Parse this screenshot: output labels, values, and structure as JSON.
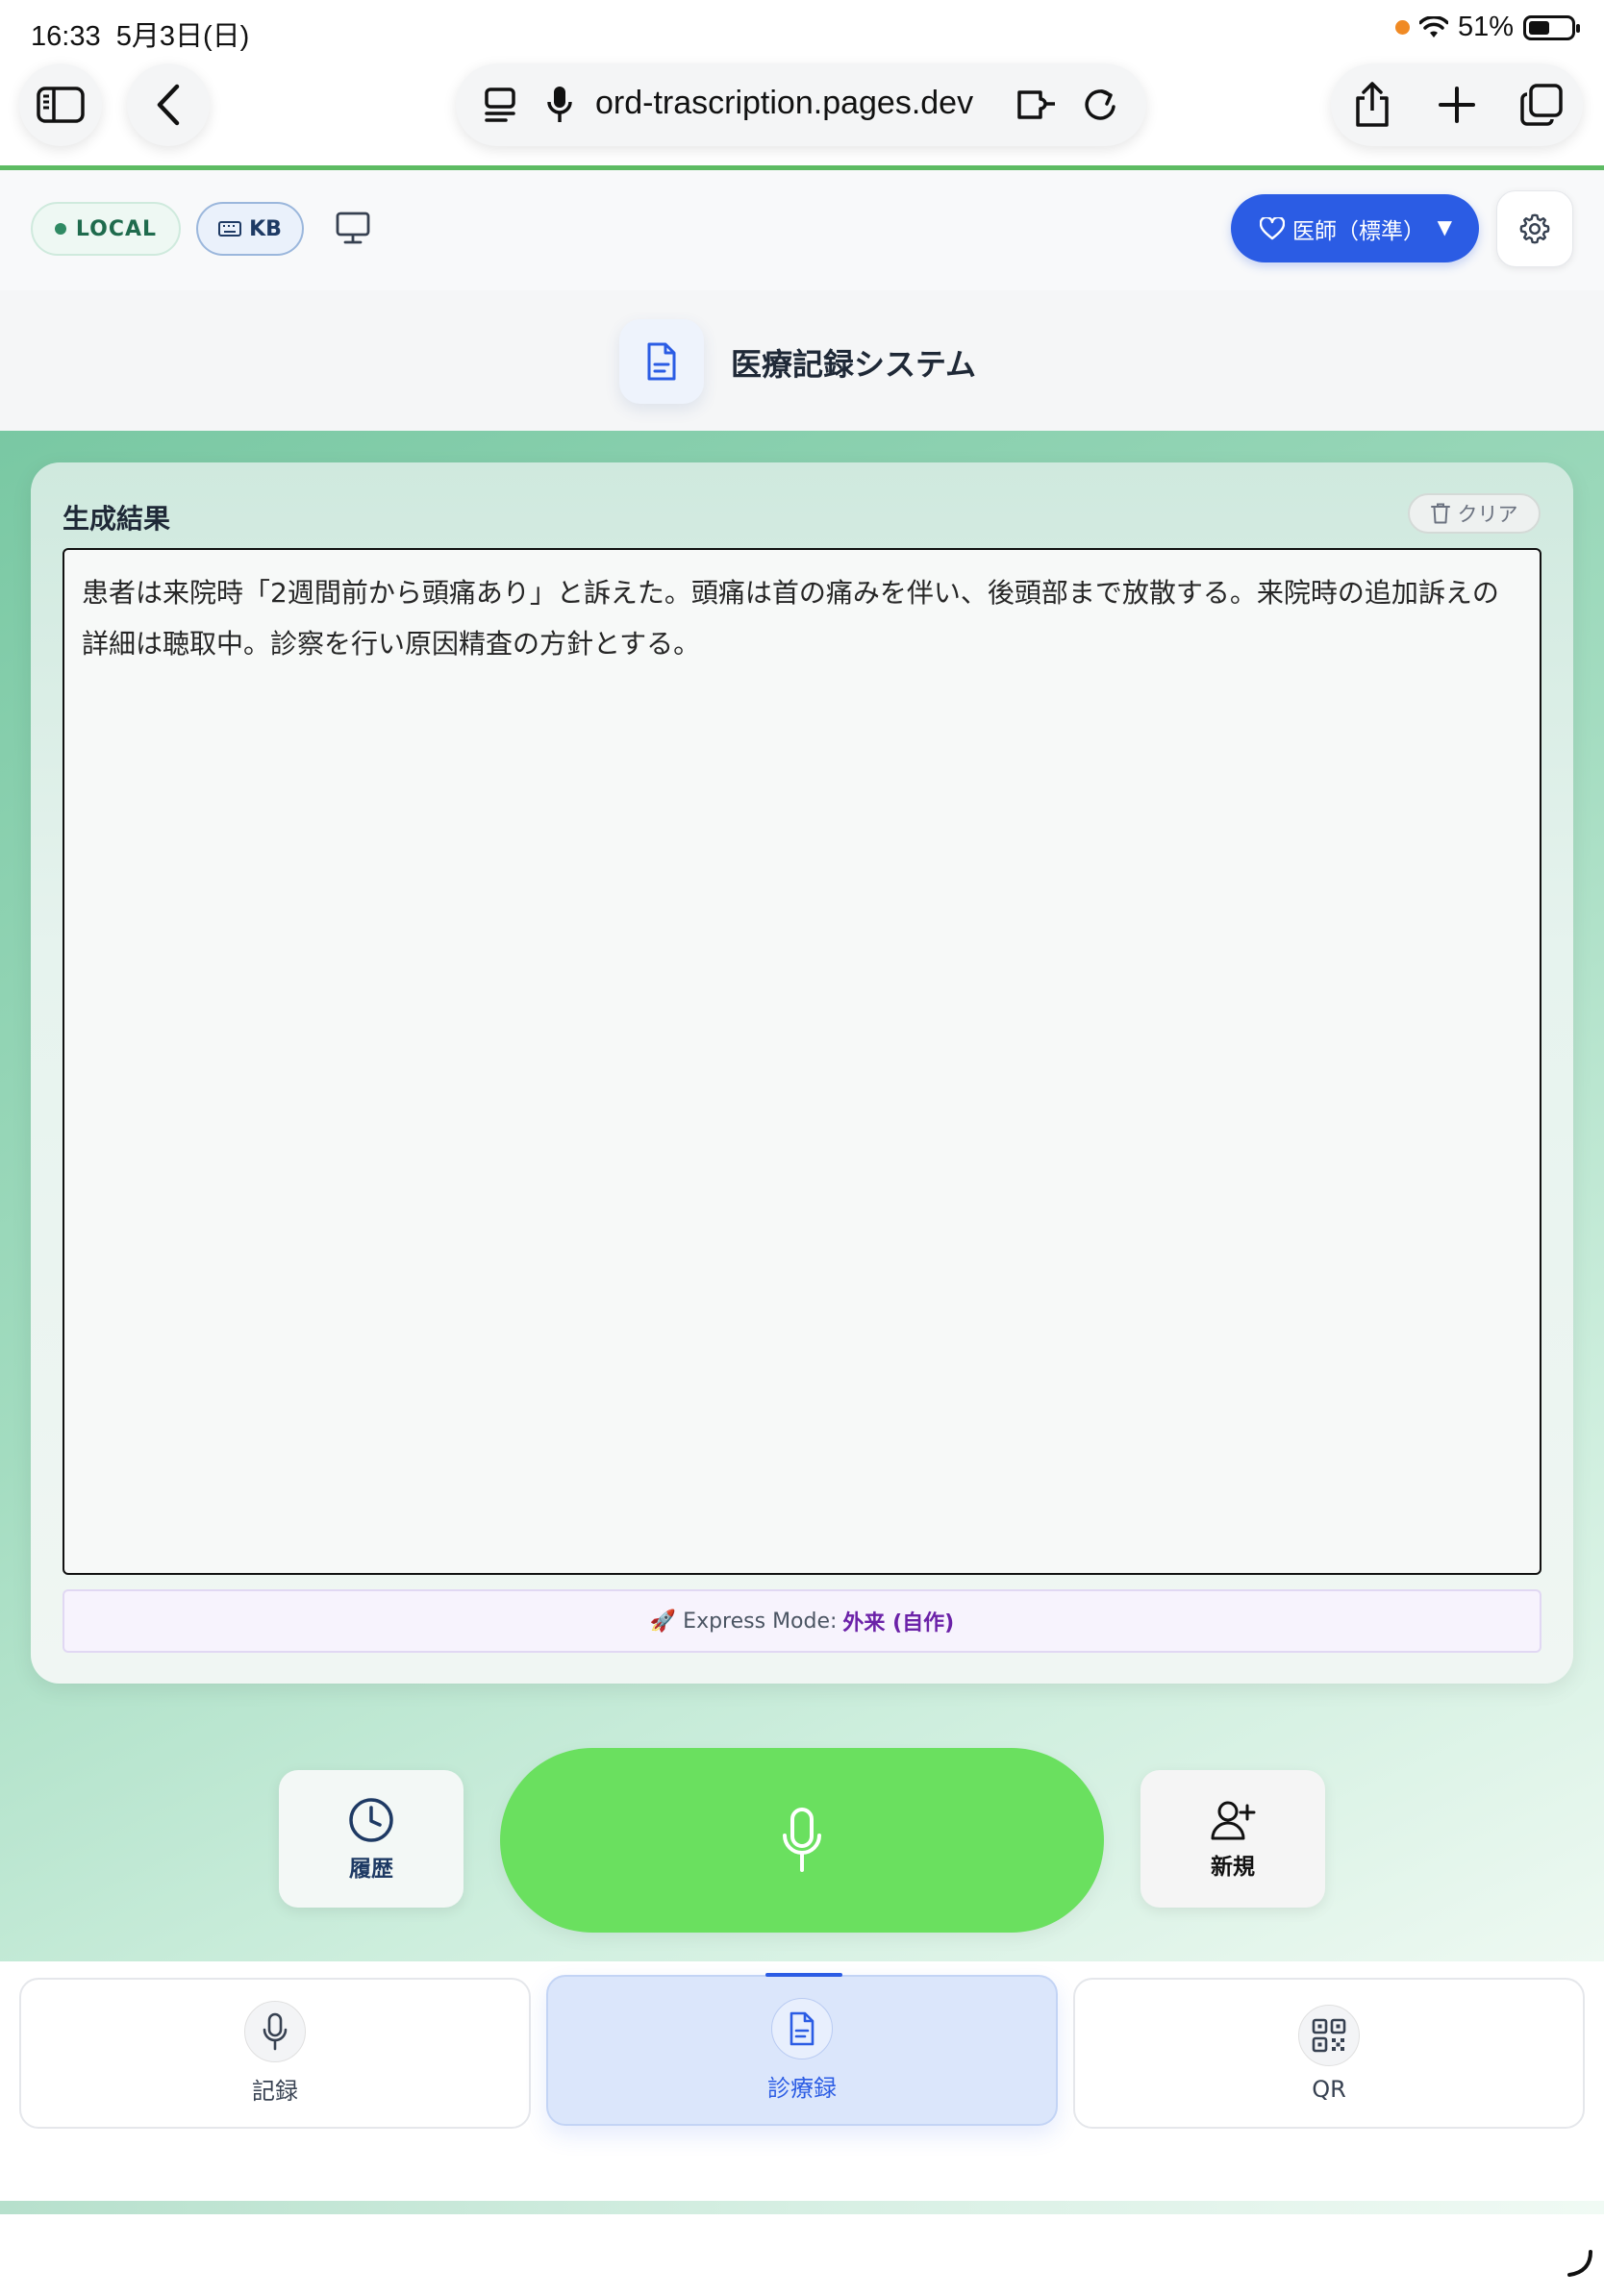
{
  "status_bar": {
    "time": "16:33",
    "date": "5月3日(日)",
    "battery_pct": "51%",
    "battery_level": 0.51
  },
  "browser": {
    "url": "ord-trascription.pages.dev"
  },
  "topbar": {
    "local_badge": "LOCAL",
    "kb_badge": "KB",
    "doctor_select": "医師（標準）",
    "doctor_caret": "▼"
  },
  "header": {
    "title": "医療記録システム"
  },
  "result": {
    "label": "生成結果",
    "clear_label": "クリア",
    "text": "患者は来院時「2週間前から頭痛あり」と訴えた。頭痛は首の痛みを伴い、後頭部まで放散する。来院時の追加訴えの詳細は聴取中。診察を行い原因精査の方針とする。",
    "express_prefix": "🚀 Express Mode:",
    "express_mode": "外来 (自作)"
  },
  "actions": {
    "history_label": "履歴",
    "new_label": "新規"
  },
  "bottom_nav": {
    "tabs": [
      {
        "label": "記録",
        "icon": "mic-icon",
        "active": false
      },
      {
        "label": "診療録",
        "icon": "document-icon",
        "active": true
      },
      {
        "label": "QR",
        "icon": "qr-icon",
        "active": false
      }
    ]
  },
  "colors": {
    "accent_blue": "#2b5ce4",
    "mic_green": "#6ae05f",
    "express_purple": "#6b21a8"
  }
}
